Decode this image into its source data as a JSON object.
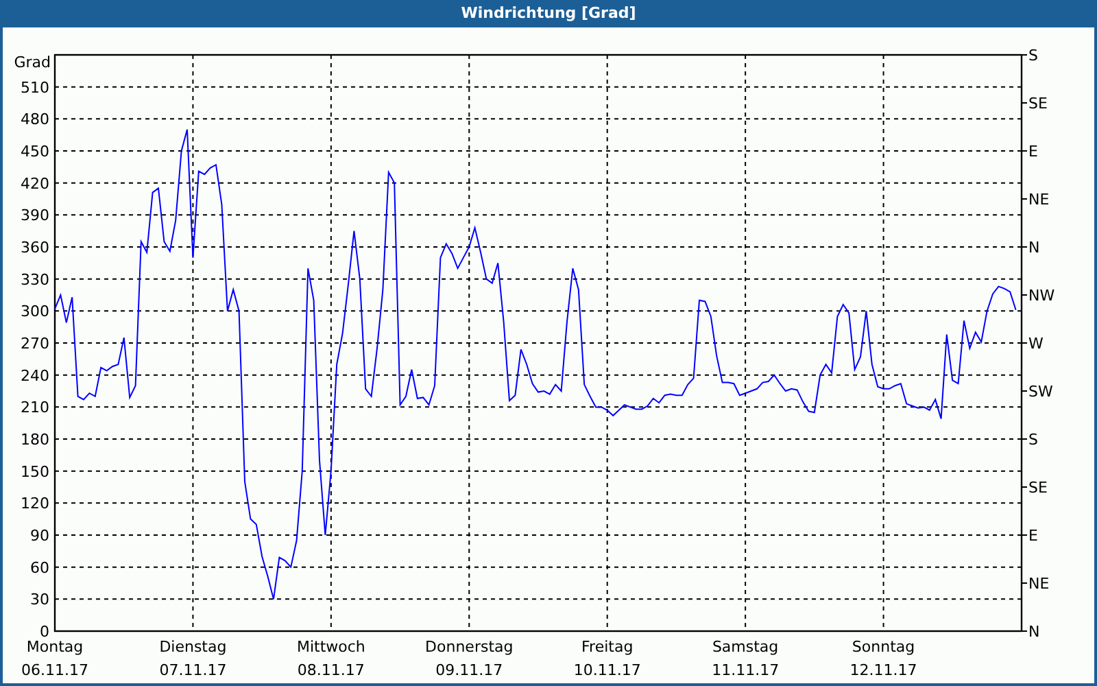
{
  "window": {
    "title": "Windrichtung [Grad]"
  },
  "chart": {
    "direction_labels": [
      "S",
      "SE",
      "E",
      "NE",
      "N",
      "NW",
      "W",
      "SW",
      "S",
      "SE",
      "E",
      "NE",
      "N"
    ],
    "chart_data": {
      "type": "line",
      "grid": true,
      "ylabel": "Grad",
      "ylim": [
        0,
        540
      ],
      "yticks": [
        0,
        30,
        60,
        90,
        120,
        150,
        180,
        210,
        240,
        270,
        300,
        330,
        360,
        390,
        420,
        450,
        480,
        510
      ],
      "categories": [
        "Montag\n06.11.17",
        null,
        null,
        null,
        null,
        null,
        null,
        null,
        null,
        null,
        null,
        null,
        null,
        null,
        null,
        null,
        null,
        null,
        null,
        null,
        null,
        null,
        null,
        null,
        "Dienstag\n07.11.17",
        null,
        null,
        null,
        null,
        null,
        null,
        null,
        null,
        null,
        null,
        null,
        null,
        null,
        null,
        null,
        null,
        null,
        null,
        null,
        null,
        null,
        null,
        null,
        "Mittwoch\n08.11.17",
        null,
        null,
        null,
        null,
        null,
        null,
        null,
        null,
        null,
        null,
        null,
        null,
        null,
        null,
        null,
        null,
        null,
        null,
        null,
        null,
        null,
        null,
        null,
        "Donnerstag\n09.11.17",
        null,
        null,
        null,
        null,
        null,
        null,
        null,
        null,
        null,
        null,
        null,
        null,
        null,
        null,
        null,
        null,
        null,
        null,
        null,
        null,
        null,
        null,
        null,
        "Freitag\n10.11.17",
        null,
        null,
        null,
        null,
        null,
        null,
        null,
        null,
        null,
        null,
        null,
        null,
        null,
        null,
        null,
        null,
        null,
        null,
        null,
        null,
        null,
        null,
        null,
        "Samstag\n11.11.17",
        null,
        null,
        null,
        null,
        null,
        null,
        null,
        null,
        null,
        null,
        null,
        null,
        null,
        null,
        null,
        null,
        null,
        null,
        null,
        null,
        null,
        null,
        null,
        "Sonntag\n12.11.17",
        null,
        null,
        null,
        null,
        null,
        null,
        null,
        null,
        null,
        null,
        null,
        null,
        null,
        null,
        null,
        null,
        null,
        null,
        null,
        null,
        null,
        null,
        null
      ],
      "series": [
        {
          "color": "#0000ff",
          "values": [
            302,
            315,
            289,
            313,
            220,
            217,
            223,
            220,
            247,
            244,
            248,
            250,
            275,
            219,
            230,
            365,
            355,
            411,
            415,
            365,
            356,
            385,
            450,
            470,
            350,
            431,
            428,
            434,
            437,
            400,
            300,
            320,
            300,
            140,
            105,
            100,
            70,
            51,
            30,
            69,
            66,
            60,
            85,
            150,
            340,
            310,
            160,
            90,
            150,
            250,
            279,
            325,
            375,
            330,
            227,
            220,
            265,
            320,
            430,
            420,
            212,
            220,
            245,
            218,
            219,
            212,
            230,
            350,
            363,
            354,
            340,
            350,
            360,
            378,
            355,
            330,
            326,
            345,
            290,
            216,
            221,
            264,
            250,
            232,
            224,
            225,
            222,
            231,
            225,
            290,
            340,
            320,
            231,
            220,
            210,
            210,
            207,
            202,
            207,
            212,
            210,
            208,
            208,
            211,
            218,
            214,
            221,
            222,
            221,
            221,
            231,
            237,
            310,
            309,
            295,
            258,
            233,
            233,
            232,
            221,
            223,
            225,
            227,
            233,
            234,
            240,
            232,
            225,
            227,
            226,
            215,
            206,
            205,
            240,
            250,
            242,
            295,
            306,
            298,
            245,
            257,
            300,
            250,
            229,
            227,
            227,
            230,
            232,
            213,
            211,
            209,
            210,
            207,
            217,
            199,
            278,
            235,
            232,
            291,
            265,
            280,
            271,
            300,
            316,
            323,
            321,
            318,
            301
          ]
        }
      ]
    }
  }
}
